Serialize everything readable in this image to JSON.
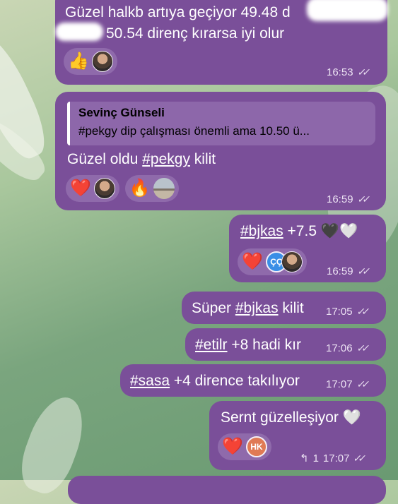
{
  "messages": [
    {
      "line1": "Güzel halkb artıya geçiyor 49.48 d",
      "line2": "50.54 direnç kırarsa  iyi olur",
      "reactions": [
        "👍"
      ],
      "time": "16:53"
    },
    {
      "quote_author": "Sevinç Günseli",
      "quote_text": "#pekgy  dip çalışması önemli ama  10.50 ü...",
      "text_pre": "Güzel oldu ",
      "hashtag": "#pekgy",
      "text_post": " kilit",
      "reactions": [
        "❤️",
        "🔥"
      ],
      "time": "16:59"
    },
    {
      "hashtag": "#bjkas",
      "text_post": " +7.5 🖤🤍",
      "reactions": [
        "❤️"
      ],
      "badge": "ÇÇ",
      "badge_color": "#3a8ee6",
      "time": "16:59"
    },
    {
      "text_pre": "Süper ",
      "hashtag": "#bjkas",
      "text_post": " kilit",
      "time": "17:05"
    },
    {
      "hashtag": "#etilr",
      "text_post": " +8  hadi kır",
      "time": "17:06"
    },
    {
      "hashtag": "#sasa",
      "text_post": " +4 dirence takılıyor",
      "time": "17:07"
    },
    {
      "text": "Sernt güzelleşiyor 🤍",
      "reactions": [
        "❤️"
      ],
      "badge": "HK",
      "badge_color": "#e07a55",
      "reply_count": "1",
      "time": "17:07"
    }
  ],
  "colors": {
    "bubble": "#7a4f99",
    "pill": "#8f6aab"
  }
}
